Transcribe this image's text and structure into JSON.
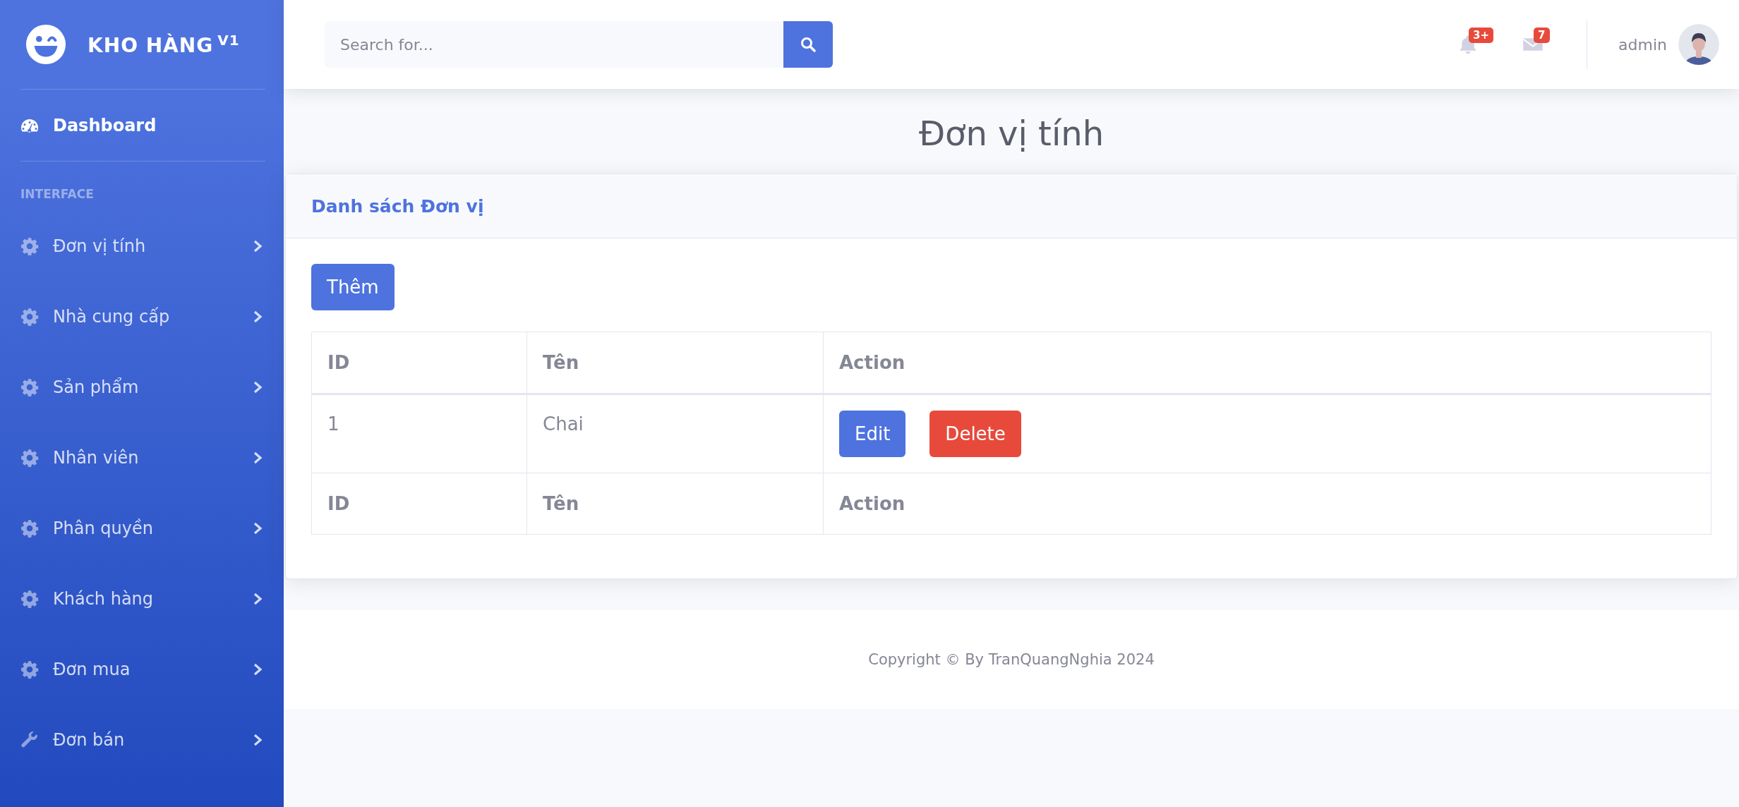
{
  "sidebar": {
    "brand": "KHO HÀNG",
    "brand_version": "V1",
    "dashboard": {
      "label": "Dashboard",
      "selected": true
    },
    "heading": "INTERFACE",
    "items": [
      {
        "label": "Đơn vị tính",
        "kind": "gear",
        "expanded": false,
        "selected": false
      },
      {
        "label": "Nhà cung cấp",
        "kind": "gear",
        "expanded": false,
        "selected": false
      },
      {
        "label": "Sản phẩm",
        "kind": "gear",
        "expanded": false,
        "selected": false
      },
      {
        "label": "Nhân viên",
        "kind": "gear",
        "expanded": false,
        "selected": false
      },
      {
        "label": "Phân quyền",
        "kind": "gear",
        "expanded": false,
        "selected": false
      },
      {
        "label": "Khách hàng",
        "kind": "gear",
        "expanded": false,
        "selected": false
      },
      {
        "label": "Đơn mua",
        "kind": "gear",
        "expanded": false,
        "selected": false
      },
      {
        "label": "Đơn bán",
        "kind": "wrench",
        "expanded": false,
        "selected": false
      }
    ]
  },
  "topbar": {
    "search": {
      "placeholder": "Search for..."
    },
    "alerts_badge": "3+",
    "messages_badge": "7",
    "user": "admin"
  },
  "page_title": "Đơn vị tính",
  "card": {
    "title": "Danh sách Đơn vị",
    "add_button": "Thêm",
    "table": {
      "columns": [
        "ID",
        "Tên",
        "Action"
      ],
      "rows": [
        {
          "cells": [
            "1",
            "Chai"
          ],
          "actions": [
            {
              "label": "Edit",
              "kind": "primary"
            },
            {
              "label": "Delete",
              "kind": "danger"
            }
          ]
        }
      ],
      "footer": [
        "ID",
        "Tên",
        "Action"
      ]
    }
  },
  "footer": "Copyright © By TranQuangNghia 2024"
}
